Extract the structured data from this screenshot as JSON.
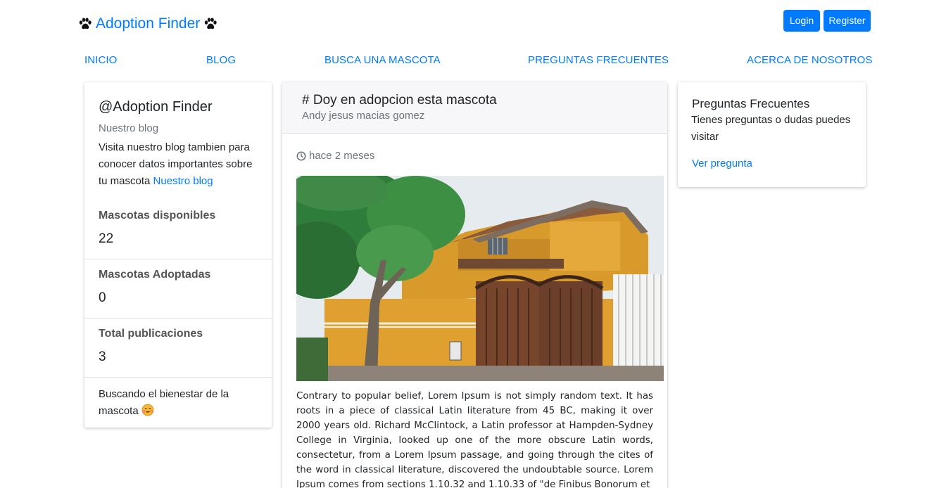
{
  "header": {
    "brand": "Adoption Finder",
    "login_label": "Login",
    "register_label": "Register"
  },
  "nav": {
    "inicio": "INICIO",
    "blog": "BLOG",
    "busca": "BUSCA UNA MASCOTA",
    "preguntas": "PREGUNTAS FRECUENTES",
    "acerca": "ACERCA DE NOSOTROS"
  },
  "sidebar": {
    "title": "@Adoption Finder",
    "subtitle": "Nuestro blog",
    "text": "Visita nuestro blog tambien para conocer datos importantes sobre tu mascota",
    "link": "Nuestro blog",
    "stats": [
      {
        "label": "Mascotas disponibles",
        "value": "22"
      },
      {
        "label": "Mascotas Adoptadas",
        "value": "0"
      },
      {
        "label": "Total publicaciones",
        "value": "3"
      }
    ],
    "footer": "Buscando el bienestar de la mascota"
  },
  "post": {
    "title": "# Doy en adopcion esta mascota",
    "author": "Andy jesus macias gomez",
    "time": "hace 2 meses",
    "body": "Contrary to popular belief, Lorem Ipsum is not simply random text. It has roots in a piece of classical Latin literature from 45 BC, making it over 2000 years old. Richard McClintock, a Latin professor at Hampden-Sydney College in Virginia, looked up one of the more obscure Latin words, consectetur, from a Lorem Ipsum passage, and going through the cites of the word in classical literature, discovered the undoubtable source. Lorem Ipsum comes from sections 1.10.32 and 1.10.33 of \"de Finibus Bonorum et"
  },
  "faq": {
    "title": "Preguntas Frecuentes",
    "text": "Tienes preguntas o dudas puedes visitar",
    "link": "Ver pregunta"
  },
  "colors": {
    "primary": "#007bff",
    "muted": "#6c757d",
    "text": "#212529"
  },
  "icons": [
    "paw-icon",
    "clock-icon",
    "smiling-face-icon"
  ]
}
